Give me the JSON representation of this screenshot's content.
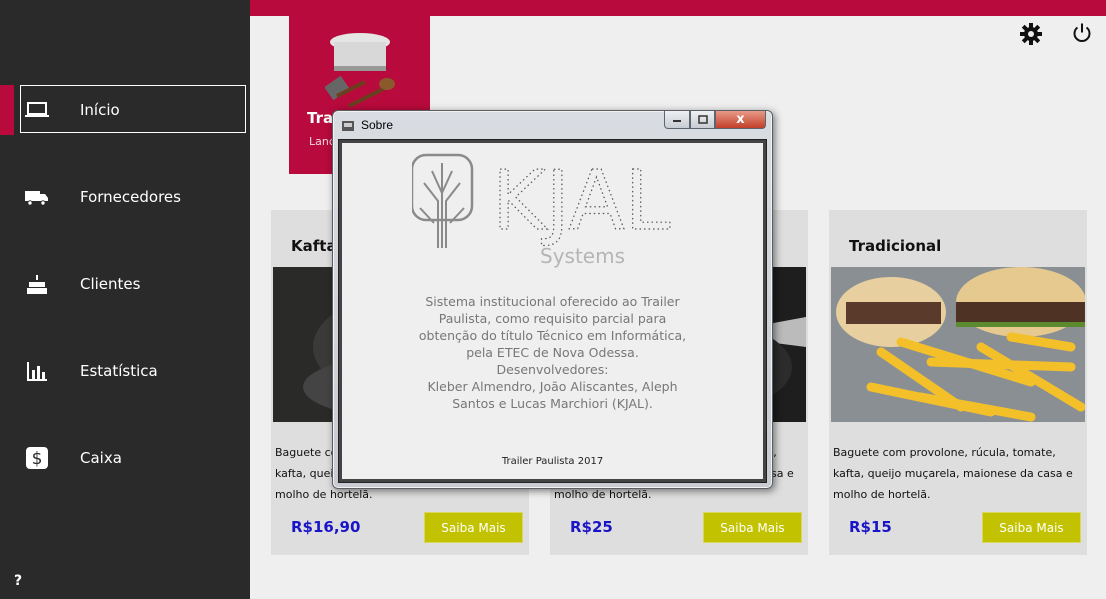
{
  "sidebar": {
    "items": [
      {
        "label": "Início",
        "icon": "laptop-icon"
      },
      {
        "label": "Fornecedores",
        "icon": "truck-icon"
      },
      {
        "label": "Clientes",
        "icon": "cake-icon"
      },
      {
        "label": "Estatística",
        "icon": "bar-chart-icon"
      },
      {
        "label": "Caixa",
        "icon": "dollar-icon"
      }
    ],
    "help": "?"
  },
  "header": {
    "settings_icon": "gear-icon",
    "power_icon": "power-icon"
  },
  "brand": {
    "title": "Trailer Paulista",
    "subtitle": "Lanches"
  },
  "cards": [
    {
      "title": "Kafta",
      "description": "Baguete com provolone, rúcula, tomate, kafta, queijo muçarela, maionese da casa e molho de hortelã.",
      "price": "R$16,90",
      "button": "Saiba Mais"
    },
    {
      "title": "",
      "description": "Baguete com provolone, rúcula, tomate, kafta, queijo muçarela, maionese da casa e molho de hortelã.",
      "price": "R$25",
      "button": "Saiba Mais"
    },
    {
      "title": "Tradicional",
      "description": "Baguete com provolone, rúcula, tomate, kafta, queijo muçarela, maionese da casa e molho de hortelã.",
      "price": "R$15",
      "button": "Saiba Mais"
    }
  ],
  "dialog": {
    "title": "Sobre",
    "logo_text": "KJAL",
    "logo_sub": "Systems",
    "text_lines": [
      "Sistema institucional oferecido ao Trailer",
      "Paulista, como requisito parcial para",
      "obtenção do título Técnico em Informática,",
      "pela ETEC de Nova Odessa.",
      "Desenvolvedores:",
      "Kleber Almendro, João Aliscantes, Aleph",
      "Santos e Lucas Marchiori (KJAL)."
    ],
    "footer": "Trailer Paulista 2017",
    "close_glyph": "x"
  },
  "colors": {
    "accent": "#b80a3c",
    "sidebar": "#2b2a2b",
    "price": "#1a14c8",
    "button": "#c2c200"
  }
}
